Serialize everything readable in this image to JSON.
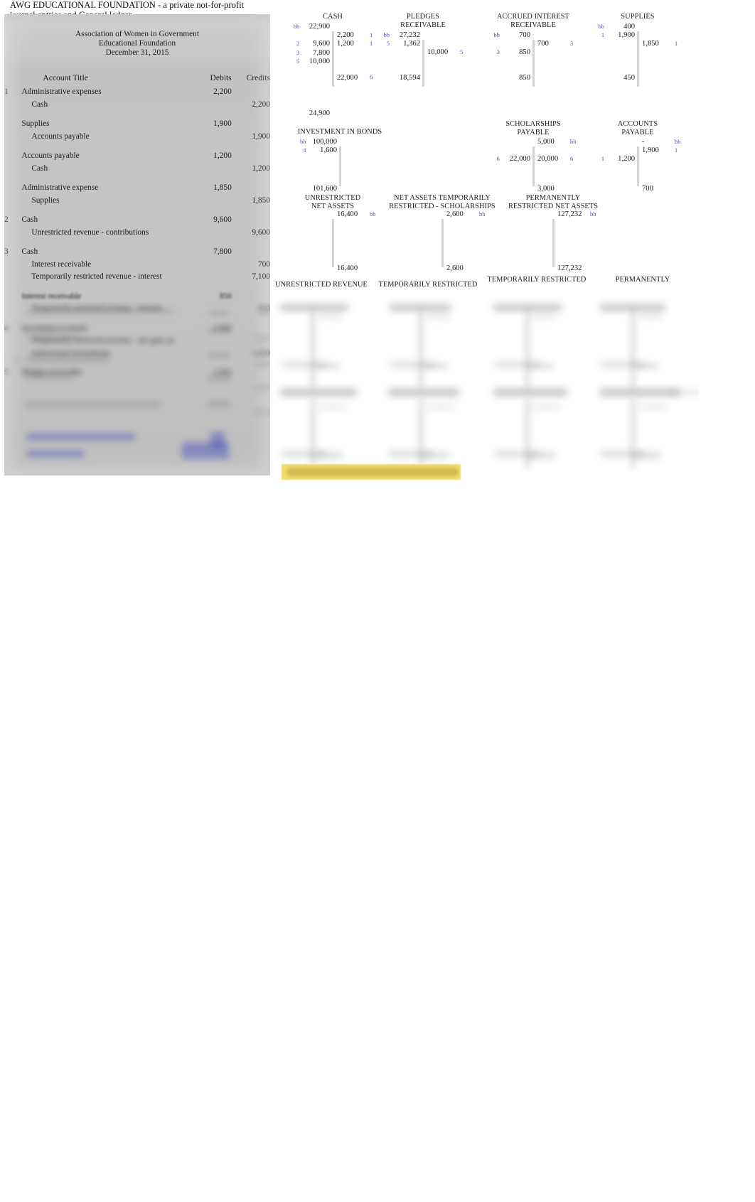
{
  "document": {
    "title_line1": "AWG EDUCATIONAL FOUNDATION - a private not-for-profit",
    "title_line2": "journal entries and General ledger"
  },
  "journal": {
    "company_line1": "Association of Women in Government",
    "company_line2": "Educational Foundation",
    "company_line3": "December 31, 2015",
    "headers": {
      "num": "",
      "account_title": "Account Title",
      "debits": "Debits",
      "credits": "Credits"
    },
    "rows": [
      {
        "num": "1",
        "title": "Administrative expenses",
        "debit": "2,200",
        "credit": "",
        "indent": 0
      },
      {
        "num": "",
        "title": "Cash",
        "debit": "",
        "credit": "2,200",
        "indent": 1
      },
      {
        "num": "",
        "title": "",
        "debit": "",
        "credit": "",
        "indent": 0,
        "spacer": true
      },
      {
        "num": "",
        "title": "Supplies",
        "debit": "1,900",
        "credit": "",
        "indent": 0
      },
      {
        "num": "",
        "title": "Accounts payable",
        "debit": "",
        "credit": "1,900",
        "indent": 1
      },
      {
        "num": "",
        "title": "",
        "debit": "",
        "credit": "",
        "indent": 0,
        "spacer": true
      },
      {
        "num": "",
        "title": "Accounts payable",
        "debit": "1,200",
        "credit": "",
        "indent": 0
      },
      {
        "num": "",
        "title": "Cash",
        "debit": "",
        "credit": "1,200",
        "indent": 1
      },
      {
        "num": "",
        "title": "",
        "debit": "",
        "credit": "",
        "indent": 0,
        "spacer": true
      },
      {
        "num": "",
        "title": "Administrative expense",
        "debit": "1,850",
        "credit": "",
        "indent": 0
      },
      {
        "num": "",
        "title": "Supplies",
        "debit": "",
        "credit": "1,850",
        "indent": 1
      },
      {
        "num": "",
        "title": "",
        "debit": "",
        "credit": "",
        "indent": 0,
        "spacer": true
      },
      {
        "num": "2",
        "title": "Cash",
        "debit": "9,600",
        "credit": "",
        "indent": 0
      },
      {
        "num": "",
        "title": "Unrestricted revenue - contributions",
        "debit": "",
        "credit": "9,600",
        "indent": 1
      },
      {
        "num": "",
        "title": "",
        "debit": "",
        "credit": "",
        "indent": 0,
        "spacer": true
      },
      {
        "num": "3",
        "title": "Cash",
        "debit": "7,800",
        "credit": "",
        "indent": 0
      },
      {
        "num": "",
        "title": "Interest receivable",
        "debit": "",
        "credit": "700",
        "indent": 1
      },
      {
        "num": "",
        "title": "Temporarily restricted revenue - interest",
        "debit": "",
        "credit": "7,100",
        "indent": 1
      },
      {
        "num": "",
        "title": "",
        "debit": "",
        "credit": "",
        "indent": 0,
        "spacer": true
      },
      {
        "num": "",
        "title": "Interest receivable",
        "debit": "850",
        "credit": "",
        "indent": 0
      },
      {
        "num": "",
        "title": "Temporarily restricted revenue - interest",
        "debit": "",
        "credit": "850",
        "indent": 1
      },
      {
        "num": "",
        "title": "",
        "debit": "",
        "credit": "",
        "indent": 0,
        "spacer": true
      },
      {
        "num": "4",
        "title": "Investment in bonds",
        "debit": "1,600",
        "credit": "",
        "indent": 0
      },
      {
        "num": "",
        "title": "Temporarily restricted revenue - net gain on",
        "debit": "",
        "credit": "",
        "indent": 1
      },
      {
        "num": "",
        "title": "endowment investments",
        "debit": "",
        "credit": "1,600",
        "indent": 1
      },
      {
        "num": "",
        "title": "",
        "debit": "",
        "credit": "",
        "indent": 0,
        "spacer": true
      },
      {
        "num": "5",
        "title": "Pledges receivable",
        "debit": "1,362",
        "credit": "",
        "indent": 0
      }
    ]
  },
  "ledger": {
    "accounts": [
      {
        "name": "CASH",
        "label": "CASH",
        "debits": [
          {
            "ref": "bb",
            "amount": "22,900"
          },
          {
            "ref": "",
            "amount": ""
          },
          {
            "ref": "2",
            "amount": "9,600"
          },
          {
            "ref": "3",
            "amount": "7,800"
          },
          {
            "ref": "5",
            "amount": "10,000"
          }
        ],
        "credits": [
          {
            "ref": "",
            "amount": ""
          },
          {
            "ref": "1",
            "amount": "2,200"
          },
          {
            "ref": "1",
            "amount": "1,200"
          }
        ],
        "total_debit": "",
        "total_credit": "22,000",
        "total_credit_ref": "6",
        "balance": "24,900"
      },
      {
        "name": "PLEDGES RECEIVABLE",
        "label": "PLEDGES\nRECEIVABLE",
        "debits": [
          {
            "ref": "bb",
            "amount": "27,232"
          },
          {
            "ref": "5",
            "amount": "1,362"
          }
        ],
        "credits": [
          {
            "ref": "",
            "amount": ""
          },
          {
            "ref": "",
            "amount": ""
          },
          {
            "ref": "5",
            "amount": "10,000"
          }
        ],
        "total_debit": "18,594",
        "total_credit": "",
        "total_credit_ref": "",
        "balance": ""
      },
      {
        "name": "ACCRUED INTEREST RECEIVABLE",
        "label": "ACCRUED INTEREST\nRECEIVABLE",
        "debits": [
          {
            "ref": "bb",
            "amount": "700"
          },
          {
            "ref": "",
            "amount": ""
          },
          {
            "ref": "3",
            "amount": "850"
          }
        ],
        "credits": [
          {
            "ref": "",
            "amount": ""
          },
          {
            "ref": "3",
            "amount": "700"
          }
        ],
        "total_debit": "850",
        "total_credit": "",
        "total_credit_ref": "",
        "balance": ""
      },
      {
        "name": "SUPPLIES",
        "label": "SUPPLIES",
        "debits": [
          {
            "ref": "bb",
            "amount": "400"
          },
          {
            "ref": "1",
            "amount": "1,900"
          }
        ],
        "credits": [
          {
            "ref": "",
            "amount": ""
          },
          {
            "ref": "",
            "amount": ""
          },
          {
            "ref": "1",
            "amount": "1,850"
          }
        ],
        "total_debit": "450",
        "total_credit": "",
        "total_credit_ref": "",
        "balance": ""
      },
      {
        "name": "INVESTMENT IN BONDS",
        "label": "INVESTMENT IN BONDS",
        "debits": [
          {
            "ref": "bb",
            "amount": "100,000"
          },
          {
            "ref": "4",
            "amount": "1,600"
          }
        ],
        "credits": [],
        "total_debit": "101,600",
        "total_credit": "",
        "total_credit_ref": "",
        "balance": ""
      },
      {
        "name": "SCHOLARSHIPS PAYABLE",
        "label": "SCHOLARSHIPS\nPAYABLE",
        "debits": [
          {
            "ref": "",
            "amount": ""
          },
          {
            "ref": "",
            "amount": ""
          },
          {
            "ref": "6",
            "amount": "22,000"
          }
        ],
        "credits": [
          {
            "ref": "bb",
            "amount": "5,000"
          },
          {
            "ref": "",
            "amount": ""
          },
          {
            "ref": "6",
            "amount": "20,000"
          }
        ],
        "total_debit": "",
        "total_credit": "3,000",
        "total_credit_ref": "",
        "balance": ""
      },
      {
        "name": "ACCOUNTS PAYABLE",
        "label": "ACCOUNTS\nPAYABLE",
        "debits": [
          {
            "ref": "",
            "amount": ""
          },
          {
            "ref": "",
            "amount": ""
          },
          {
            "ref": "1",
            "amount": "1,200"
          }
        ],
        "credits": [
          {
            "ref": "bb",
            "amount": "-"
          },
          {
            "ref": "1",
            "amount": "1,900"
          }
        ],
        "total_debit": "",
        "total_credit": "700",
        "total_credit_ref": "",
        "balance": ""
      },
      {
        "name": "UNRESTRICTED NET ASSETS",
        "label": "UNRESTRICTED\nNET ASSETS",
        "debits": [],
        "credits": [
          {
            "ref": "bb",
            "amount": "16,400"
          }
        ],
        "total_debit": "",
        "total_credit": "16,400",
        "total_credit_ref": "",
        "balance": ""
      },
      {
        "name": "NET ASSETS TEMPORARILY RESTRICTED - SCHOLARSHIPS",
        "label": "NET ASSETS TEMPORARILY\nRESTRICTED - SCHOLARSHIPS",
        "debits": [],
        "credits": [
          {
            "ref": "bb",
            "amount": "2,600"
          }
        ],
        "total_debit": "",
        "total_credit": "2,600",
        "total_credit_ref": "",
        "balance": ""
      },
      {
        "name": "PERMANENTLY RESTRICTED NET ASSETS",
        "label": "PERMANENTLY\nRESTRICTED NET ASSETS",
        "debits": [],
        "credits": [
          {
            "ref": "bb",
            "amount": "127,232"
          }
        ],
        "total_debit": "",
        "total_credit": "127,232",
        "total_credit_ref": "",
        "balance": ""
      }
    ],
    "bottom_row_labels": [
      "UNRESTRICTED REVENUE",
      "TEMPORARILY RESTRICTED",
      "TEMPORARILY RESTRICTED",
      "PERMANENTLY"
    ]
  }
}
